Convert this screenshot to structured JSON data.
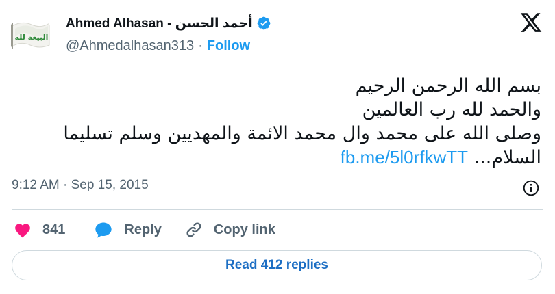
{
  "author": {
    "display_name": "Ahmed Alhasan - أحمد الحسن",
    "handle": "@Ahmedalhasan313",
    "separator": "·",
    "follow_label": "Follow",
    "avatar_flag_text": "البيعة لله",
    "verified_color": "#1d9bf0"
  },
  "tweet": {
    "lines": [
      "بسم الله الرحمن الرحيم",
      "والحمد لله رب العالمين",
      "وصلى الله على محمد وال محمد الائمة والمهديين وسلم تسليما"
    ],
    "last_line_text": "السلام...",
    "link_text": "fb.me/5l0rfkwTT"
  },
  "meta": {
    "timestamp": "9:12 AM · Sep 15, 2015"
  },
  "actions": {
    "like_count": "841",
    "reply_label": "Reply",
    "copy_link_label": "Copy link"
  },
  "read_replies_label": "Read 412 replies",
  "colors": {
    "like": "#f91880",
    "accent": "#1d9bf0",
    "muted": "#536471",
    "border": "#cfd9de"
  },
  "icons": [
    "verified-badge-icon",
    "x-logo-icon",
    "info-icon",
    "heart-icon",
    "reply-bubble-icon",
    "link-icon"
  ]
}
